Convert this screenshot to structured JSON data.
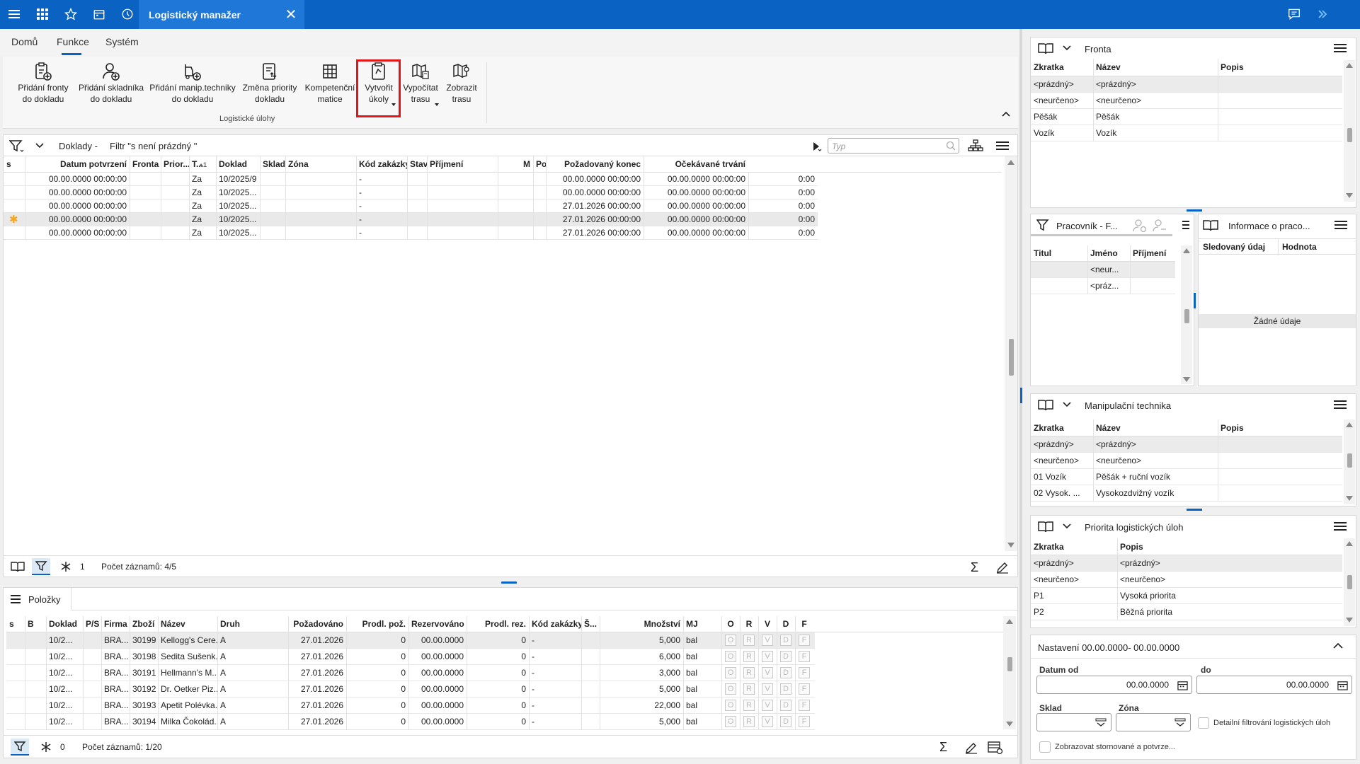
{
  "titlebar": {
    "tab_title": "Logistický manažer",
    "close": "✕"
  },
  "menu": {
    "tabs": [
      "Domů",
      "Funkce",
      "Systém"
    ],
    "active": "Funkce"
  },
  "ribbon": {
    "buttons": [
      {
        "label1": "Přidání fronty",
        "label2": "do dokladu"
      },
      {
        "label1": "Přidání skladníka",
        "label2": "do dokladu"
      },
      {
        "label1": "Přidání manip.techniky",
        "label2": "do dokladu"
      },
      {
        "label1": "Změna priority",
        "label2": "dokladu"
      },
      {
        "label1": "Kompetenční",
        "label2": "matice"
      },
      {
        "label1": "Vytvořit",
        "label2": "úkoly"
      },
      {
        "label1": "Vypočítat",
        "label2": "trasu"
      },
      {
        "label1": "Zobrazit",
        "label2": "trasu"
      }
    ],
    "group_label": "Logistické úlohy"
  },
  "doklady": {
    "title": "Doklady -",
    "filter": "Filtr \"s není prázdný \"",
    "search_placeholder": "Typ",
    "columns": [
      "s",
      "Datum potvrzení",
      "Fronta",
      "Prior...",
      "T...",
      "Doklad",
      "Sklad",
      "Zóna",
      "Kód zakázky",
      "Stav",
      "Příjmení",
      "M",
      "Požadovaný začátek",
      "Požadovaný konec",
      "Očekávané trvání"
    ],
    "sort_indicator": "1",
    "rows": [
      {
        "s": "",
        "datum": "00.00.0000 00:00:00",
        "t": "Za",
        "doklad": "10/2025/9",
        "kod": "-",
        "zacatek": "00.00.0000 00:00:00",
        "konec": "00.00.0000 00:00:00",
        "trvani": "0:00"
      },
      {
        "s": "",
        "datum": "00.00.0000 00:00:00",
        "t": "Za",
        "doklad": "10/2025...",
        "kod": "-",
        "zacatek": "00.00.0000 00:00:00",
        "konec": "00.00.0000 00:00:00",
        "trvani": "0:00"
      },
      {
        "s": "",
        "datum": "00.00.0000 00:00:00",
        "t": "Za",
        "doklad": "10/2025...",
        "kod": "-",
        "zacatek": "27.01.2026 00:00:00",
        "konec": "00.00.0000 00:00:00",
        "trvani": "0:00"
      },
      {
        "s": "✱",
        "datum": "00.00.0000 00:00:00",
        "t": "Za",
        "doklad": "10/2025...",
        "kod": "-",
        "zacatek": "27.01.2026 00:00:00",
        "konec": "00.00.0000 00:00:00",
        "trvani": "0:00"
      },
      {
        "s": "",
        "datum": "00.00.0000 00:00:00",
        "t": "Za",
        "doklad": "10/2025...",
        "kod": "-",
        "zacatek": "27.01.2026 00:00:00",
        "konec": "00.00.0000 00:00:00",
        "trvani": "0:00"
      }
    ],
    "footer_count_icon": "1",
    "footer_records": "Počet záznamů: 4/5"
  },
  "polozky": {
    "tab": "Položky",
    "columns": [
      "s",
      "B",
      "Doklad",
      "P/S",
      "Firma",
      "Zboží",
      "Název",
      "Druh",
      "Požadováno",
      "Prodl. pož.",
      "Rezervováno",
      "Prodl. rez.",
      "Kód zakázky",
      "Š...",
      "Množství",
      "MJ",
      "O",
      "R",
      "V",
      "D",
      "F"
    ],
    "rows": [
      {
        "doklad": "10/2...",
        "firma": "BRA...",
        "zbozi": "30199",
        "nazev": "Kellogg's Cere...",
        "druh": "A",
        "pozad": "27.01.2026",
        "prodl": "0",
        "rez": "00.00.0000",
        "prodlrez": "0",
        "kod": "-",
        "mnozstvi": "5,000",
        "mj": "bal"
      },
      {
        "doklad": "10/2...",
        "firma": "BRA...",
        "zbozi": "30198",
        "nazev": "Sedita Sušenk...",
        "druh": "A",
        "pozad": "27.01.2026",
        "prodl": "0",
        "rez": "00.00.0000",
        "prodlrez": "0",
        "kod": "-",
        "mnozstvi": "6,000",
        "mj": "bal"
      },
      {
        "doklad": "10/2...",
        "firma": "BRA...",
        "zbozi": "30191",
        "nazev": "Hellmann's M...",
        "druh": "A",
        "pozad": "27.01.2026",
        "prodl": "0",
        "rez": "00.00.0000",
        "prodlrez": "0",
        "kod": "-",
        "mnozstvi": "3,000",
        "mj": "bal"
      },
      {
        "doklad": "10/2...",
        "firma": "BRA...",
        "zbozi": "30192",
        "nazev": "Dr. Oetker Piz...",
        "druh": "A",
        "pozad": "27.01.2026",
        "prodl": "0",
        "rez": "00.00.0000",
        "prodlrez": "0",
        "kod": "-",
        "mnozstvi": "5,000",
        "mj": "bal"
      },
      {
        "doklad": "10/2...",
        "firma": "BRA...",
        "zbozi": "30193",
        "nazev": "Apetit Polévka...",
        "druh": "A",
        "pozad": "27.01.2026",
        "prodl": "0",
        "rez": "00.00.0000",
        "prodlrez": "0",
        "kod": "-",
        "mnozstvi": "22,000",
        "mj": "bal"
      },
      {
        "doklad": "10/2...",
        "firma": "BRA...",
        "zbozi": "30194",
        "nazev": "Milka Čokolád...",
        "druh": "A",
        "pozad": "27.01.2026",
        "prodl": "0",
        "rez": "00.00.0000",
        "prodlrez": "0",
        "kod": "-",
        "mnozstvi": "5,000",
        "mj": "bal"
      }
    ],
    "flags": [
      "O",
      "R",
      "V",
      "D",
      "F"
    ],
    "footer_count_icon": "0",
    "footer_records": "Počet záznamů: 1/20"
  },
  "fronta": {
    "title": "Fronta",
    "columns": [
      "Zkratka",
      "Název",
      "Popis"
    ],
    "rows": [
      [
        "<prázdný>",
        "<prázdný>"
      ],
      [
        "<neurčeno>",
        "<neurčeno>"
      ],
      [
        "Pěšák",
        "Pěšák"
      ],
      [
        "Vozík",
        "Vozík"
      ]
    ]
  },
  "pracovnik": {
    "title": "Pracovník - F...",
    "columns": [
      "Titul",
      "Jméno",
      "Příjmení"
    ],
    "rows": [
      [
        "",
        "<neur..."
      ],
      [
        "",
        "<práz..."
      ]
    ]
  },
  "informace": {
    "title": "Informace o praco...",
    "columns": [
      "Sledovaný údaj",
      "Hodnota"
    ],
    "empty": "Žádné údaje"
  },
  "manip": {
    "title": "Manipulační technika",
    "columns": [
      "Zkratka",
      "Název",
      "Popis"
    ],
    "rows": [
      [
        "<prázdný>",
        "<prázdný>"
      ],
      [
        "<neurčeno>",
        "<neurčeno>"
      ],
      [
        "01 Vozík",
        "Pěšák + ruční vozík"
      ],
      [
        "02 Vysok. ...",
        "Vysokozdvižný vozík"
      ]
    ]
  },
  "priorita": {
    "title": "Priorita logistických úloh",
    "columns": [
      "Zkratka",
      "Popis"
    ],
    "rows": [
      [
        "<prázdný>",
        "<prázdný>"
      ],
      [
        "<neurčeno>",
        "<neurčeno>"
      ],
      [
        "P1",
        "Vysoká priorita"
      ],
      [
        "P2",
        "Běžná priorita"
      ]
    ]
  },
  "nastaveni": {
    "title": "Nastavení 00.00.0000- 00.00.0000",
    "datum_od_label": "Datum od",
    "datum_od": "00.00.0000",
    "do_label": "do",
    "do": "00.00.0000",
    "sklad_label": "Sklad",
    "zona_label": "Zóna",
    "detail_label": "Detailní filtrování logistických úloh",
    "storno_label": "Zobrazovat stornované a potvrze..."
  },
  "colors": {
    "titlebar": "#0a63c2",
    "active_tab": "#1f78d8",
    "highlight_border": "#e0161b",
    "star": "#f5a623"
  }
}
